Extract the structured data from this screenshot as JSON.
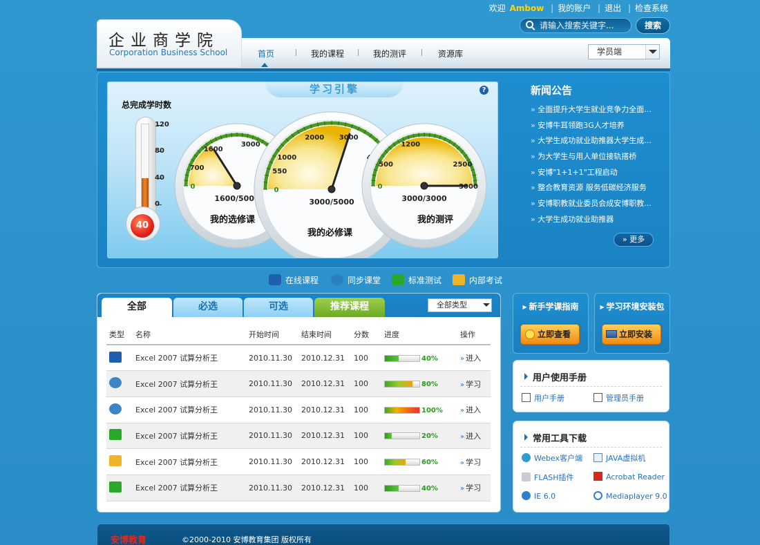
{
  "header": {
    "welcome": "欢迎",
    "username": "Ambow",
    "links": [
      "我的账户",
      "退出",
      "检查系统"
    ],
    "search_placeholder": "请输入搜索关键字...",
    "search_button": "搜索",
    "logo_cn": "企业商学院",
    "logo_en": "Corporation Business School",
    "nav": [
      "首页",
      "我的课程",
      "我的测评",
      "资源库"
    ],
    "active_nav": "首页",
    "role_select": "学员端"
  },
  "engine": {
    "title": "学习引擎",
    "help": "?",
    "thermometer": {
      "title": "总完成学时数",
      "value": 40,
      "max": 120,
      "ticks": [
        "120",
        "80",
        "40",
        "0"
      ]
    },
    "gauges": [
      {
        "name": "我的选修课",
        "value": 1600,
        "max": 5000,
        "readout": "1600/5000",
        "ticks": [
          "0",
          "700",
          "1600",
          "3000",
          "5000"
        ]
      },
      {
        "name": "我的必修课",
        "value": 3000,
        "max": 5000,
        "readout": "3000/5000",
        "ticks": [
          "0",
          "550",
          "1000",
          "2000",
          "3000",
          "4000",
          "5000"
        ]
      },
      {
        "name": "我的测评",
        "value": 3000,
        "max": 3000,
        "readout": "3000/3000",
        "ticks": [
          "0",
          "500",
          "1200",
          "2500",
          "3000"
        ]
      }
    ]
  },
  "news": {
    "title": "新闻公告",
    "items": [
      "全面提升大学生就业竞争力全面...",
      "安博牛耳领跑3G人才培养",
      "大学生成功就业助推器大学生成...",
      "为大学生与用人单位接轨搭桥",
      "安博\"1+1+1\"工程启动",
      "整合教育资源 服务低碳经济服务",
      "安博职教就业委员会成安博职教...",
      "大学生成功就业助推器"
    ],
    "more": "» 更多"
  },
  "quicklinks": [
    {
      "label": "在线课程",
      "icon": "online-course-icon",
      "color": "#1f5fae"
    },
    {
      "label": "同步课堂",
      "icon": "sync-class-icon",
      "color": "#2a7fc2"
    },
    {
      "label": "标准测试",
      "icon": "standard-test-icon",
      "color": "#2aa82a"
    },
    {
      "label": "内部考试",
      "icon": "internal-exam-icon",
      "color": "#f0b429"
    }
  ],
  "courses": {
    "tabs": [
      "全部",
      "必选",
      "可选",
      "推荐课程"
    ],
    "filter": "全部类型",
    "columns": [
      "类型",
      "名称",
      "开始时间",
      "结束时间",
      "分数",
      "进度",
      "操作"
    ],
    "rows": [
      {
        "type": "video",
        "name": "Excel 2007 试算分析王",
        "start": "2010.11.30",
        "end": "2010.12.31",
        "score": "100",
        "progress": 40,
        "progress_text": "40%",
        "action": "进入"
      },
      {
        "type": "sync",
        "name": "Excel 2007 试算分析王",
        "start": "2010.11.30",
        "end": "2010.12.31",
        "score": "100",
        "progress": 80,
        "progress_text": "80%",
        "action": "学习"
      },
      {
        "type": "sync",
        "name": "Excel 2007 试算分析王",
        "start": "2010.11.30",
        "end": "2010.12.31",
        "score": "100",
        "progress": 100,
        "progress_text": "100%",
        "action": "进入"
      },
      {
        "type": "test",
        "name": "Excel 2007 试算分析王",
        "start": "2010.11.30",
        "end": "2010.12.31",
        "score": "100",
        "progress": 20,
        "progress_text": "20%",
        "action": "进入"
      },
      {
        "type": "exam",
        "name": "Excel 2007 试算分析王",
        "start": "2010.11.30",
        "end": "2010.12.31",
        "score": "100",
        "progress": 60,
        "progress_text": "60%",
        "action": "学习"
      },
      {
        "type": "test",
        "name": "Excel 2007 试算分析王",
        "start": "2010.11.30",
        "end": "2010.12.31",
        "score": "100",
        "progress": 40,
        "progress_text": "40%",
        "action": "学习"
      }
    ]
  },
  "sidebar": {
    "guide": {
      "title": "新手学课指南",
      "button": "立即查看"
    },
    "install": {
      "title": "学习环境安装包",
      "button": "立即安装"
    },
    "manual": {
      "title": "用户使用手册",
      "links": [
        "用户手册",
        "管理员手册"
      ]
    },
    "tools": {
      "title": "常用工具下载",
      "links": [
        "Webex客户端",
        "JAVA虚拟机",
        "FLASH插件",
        "Acrobat Reader",
        "IE 6.0",
        "Mediaplayer 9.0"
      ]
    }
  },
  "footer": {
    "logo": "安博教育",
    "copyright": "©2000-2010 安博教育集团 版权所有"
  },
  "colors": {
    "accent": "#1b83c4",
    "progress_green": "#2a9a1e",
    "orange_button": "#f08a12"
  }
}
